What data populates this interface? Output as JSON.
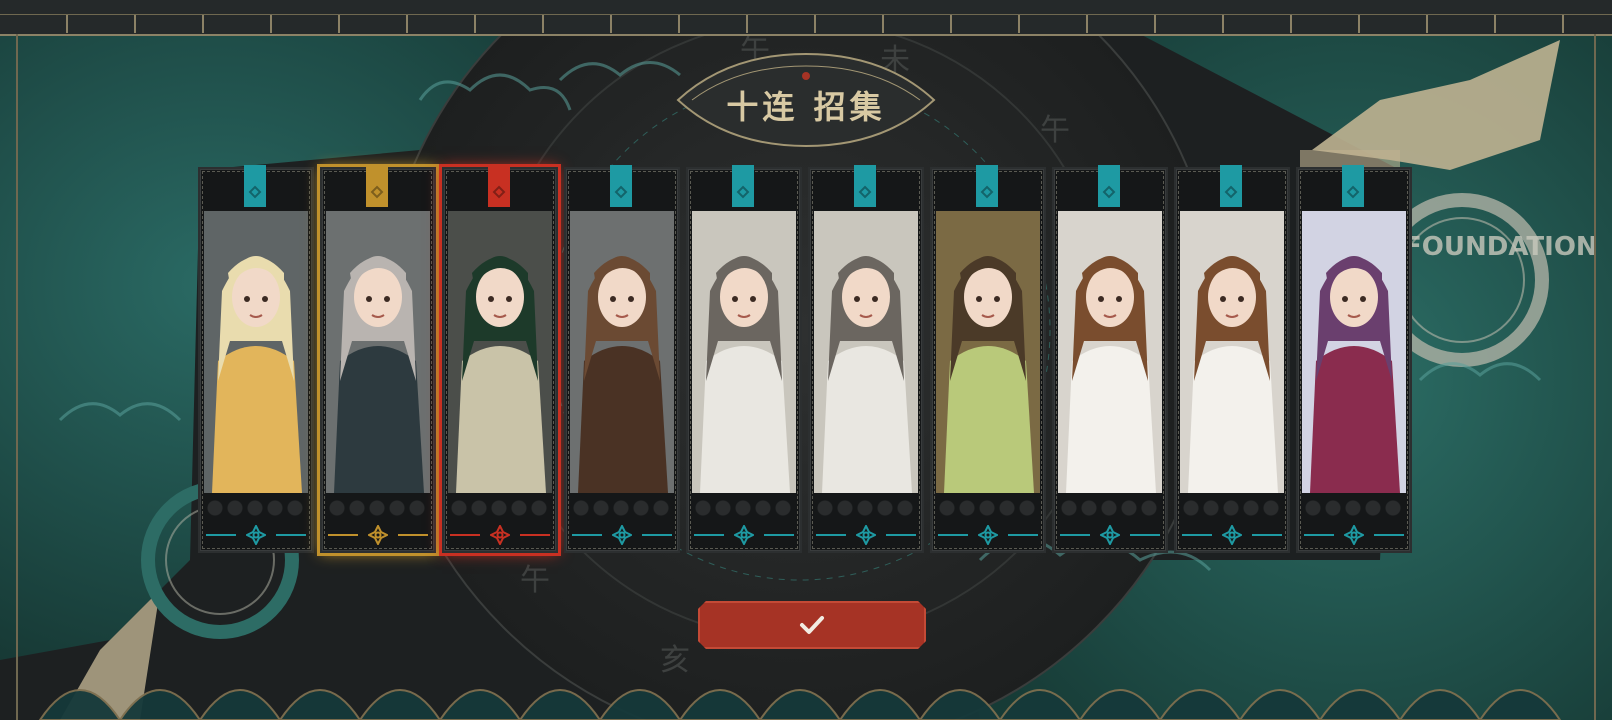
{
  "recruit": {
    "title": "十连 招集",
    "confirm_label": "Confirm",
    "background_text": "FOUNDATION",
    "zodiac_glyph": "午",
    "rarity_colors": {
      "common": "#1e9aa3",
      "rare": "#c0912c",
      "ultra": "#c83022"
    },
    "cards": [
      {
        "name": "blonde-braided-hero",
        "rarity": "common"
      },
      {
        "name": "silver-hair-cap-hero",
        "rarity": "rare"
      },
      {
        "name": "green-hair-ornate-hero",
        "rarity": "ultra"
      },
      {
        "name": "glasses-scholar-hero",
        "rarity": "common"
      },
      {
        "name": "green-cap-boy-hero",
        "rarity": "common"
      },
      {
        "name": "green-cap-boy-hero",
        "rarity": "common"
      },
      {
        "name": "archer-girl-hero",
        "rarity": "common"
      },
      {
        "name": "court-lady-hero",
        "rarity": "common"
      },
      {
        "name": "court-lady-hero",
        "rarity": "common"
      },
      {
        "name": "white-cap-girl-hero",
        "rarity": "common"
      }
    ]
  }
}
